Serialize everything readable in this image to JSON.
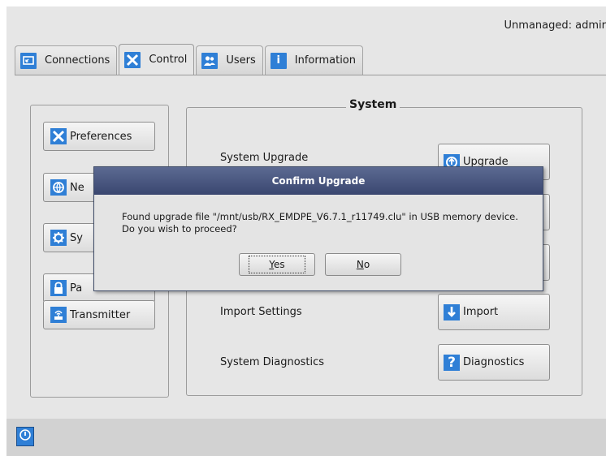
{
  "header": {
    "status": "Unmanaged: admir"
  },
  "tabs": [
    {
      "label": "Connections",
      "icon": "connections-icon"
    },
    {
      "label": "Control",
      "icon": "tools-icon"
    },
    {
      "label": "Users",
      "icon": "users-icon"
    },
    {
      "label": "Information",
      "icon": "info-icon"
    }
  ],
  "active_tab": "Control",
  "sidebar": {
    "items": [
      {
        "label": "Preferences",
        "icon": "tools-icon"
      },
      {
        "label": "Ne",
        "icon": "network-icon"
      },
      {
        "label": "Sy",
        "icon": "gear-icon"
      },
      {
        "label": "Pa",
        "icon": "lock-icon"
      },
      {
        "label": "Transmitter",
        "icon": "transmitter-icon"
      }
    ]
  },
  "system": {
    "title": "System",
    "rows": [
      {
        "label": "System Upgrade",
        "button": "Upgrade",
        "icon": "upgrade-icon"
      },
      {
        "label": "Import Settings",
        "button": "Import",
        "icon": "import-icon"
      },
      {
        "label": "System Diagnostics",
        "button": "Diagnostics",
        "icon": "help-icon"
      }
    ]
  },
  "dialog": {
    "title": "Confirm Upgrade",
    "line1": "Found upgrade file \"/mnt/usb/RX_EMDPE_V6.7.1_r11749.clu\" in USB memory device.",
    "line2": "Do you wish to proceed?",
    "yes_mnemonic": "Y",
    "yes_rest": "es",
    "no_mnemonic": "N",
    "no_rest": "o"
  },
  "colors": {
    "accent": "#2f7fd6",
    "dialog_title": "#47547c",
    "background": "#e6e6e6"
  }
}
